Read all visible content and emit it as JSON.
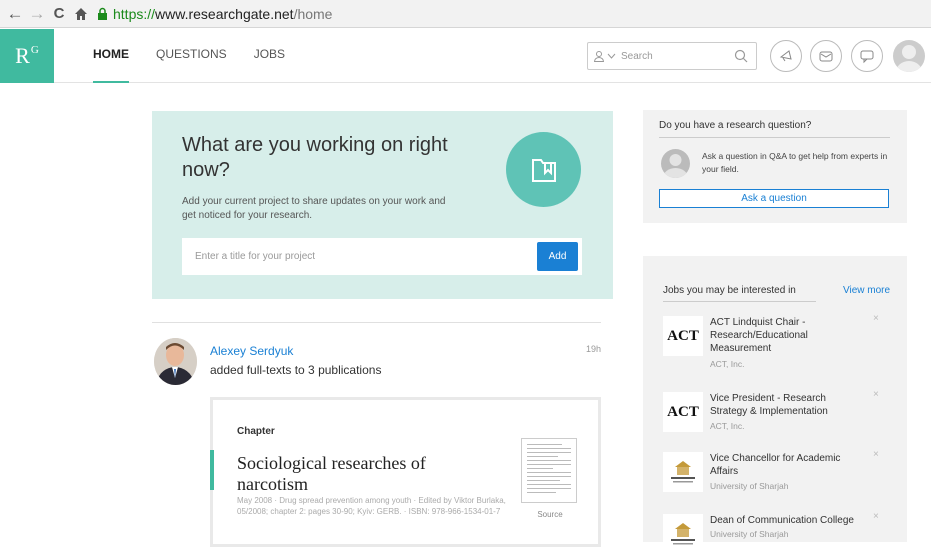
{
  "browser": {
    "url_scheme": "https://",
    "url_host": "www.researchgate.net",
    "url_path": "/home"
  },
  "header": {
    "logo": "R",
    "logo_sup": "G",
    "nav": [
      "HOME",
      "QUESTIONS",
      "JOBS"
    ],
    "search_placeholder": "Search"
  },
  "project": {
    "heading": "What are you working on right now?",
    "description": "Add your current project to share updates on your work and get noticed for your research.",
    "input_placeholder": "Enter a title for your project",
    "add_label": "Add"
  },
  "feed": {
    "name": "Alexey Serdyuk",
    "action": "added full-texts to 3 publications",
    "time": "19h",
    "publication": {
      "type": "Chapter",
      "title": "Sociological researches of narcotism",
      "meta": "May 2008 · Drug spread prevention among youth · Edited by Viktor Burlaka, 05/2008; chapter 2: pages 30-90; Kyiv: GERB. · ISBN: 978-966-1534-01-7",
      "source_label": "Source"
    }
  },
  "question_box": {
    "title": "Do you have a research question?",
    "description": "Ask a question in Q&A to get help from experts in your field.",
    "button": "Ask a question"
  },
  "jobs": {
    "header": "Jobs you may be interested in",
    "view_more": "View more",
    "items": [
      {
        "title": "ACT Lindquist Chair - Research/Educational Measurement",
        "company": "ACT, Inc.",
        "logo": "ACT"
      },
      {
        "title": "Vice President - Research Strategy & Implementation",
        "company": "ACT, Inc.",
        "logo": "ACT"
      },
      {
        "title": "Vice Chancellor for Academic Affairs",
        "company": "University of Sharjah",
        "logo": ""
      },
      {
        "title": "Dean of Communication College",
        "company": "University of Sharjah",
        "logo": ""
      }
    ]
  },
  "colors": {
    "brand": "#40ba9f",
    "link": "#1a80d4",
    "card_bg": "#d7eeea"
  }
}
